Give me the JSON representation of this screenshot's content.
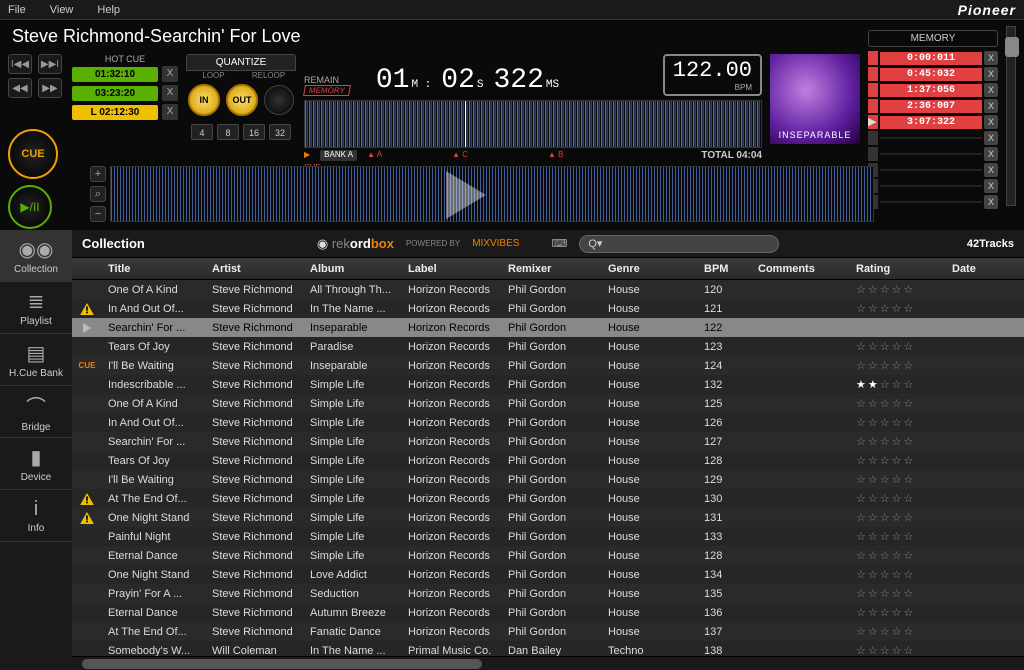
{
  "menu": {
    "file": "File",
    "view": "View",
    "help": "Help",
    "brand": "Pioneer"
  },
  "nowplaying": {
    "title": "Steve Richmond-Searchin' For Love",
    "hot_cue_label": "HOT   CUE",
    "cues": [
      {
        "time": "01:32:10",
        "color": "green"
      },
      {
        "time": "03:23:20",
        "color": "green"
      },
      {
        "time": "L 02:12:30",
        "color": "orange"
      }
    ],
    "cue_btn": "CUE",
    "play_btn": "▶/II",
    "quantize": "QUANTIZE",
    "loop": "LOOP",
    "reloop": "RELOOP",
    "in": "IN",
    "out": "OUT",
    "beats": [
      "4",
      "8",
      "16",
      "32"
    ],
    "remain": "REMAIN",
    "memory_tag": "MEMORY",
    "time_m": "01",
    "time_s": "02",
    "time_ms": "322",
    "unit_m": "M :",
    "unit_s": "S",
    "unit_ms": "MS",
    "bpm": "122.00",
    "bpm_label": "BPM",
    "bank": "BANK A",
    "cue_label": "CUE",
    "markers": [
      "▲ A",
      "▲ B",
      "▲ C"
    ],
    "total": "TOTAL 04:04",
    "album_art": "INSEPARABLE"
  },
  "memory": {
    "header": "MEMORY",
    "slots": [
      "0:00:011",
      "0:45:032",
      "1:37:056",
      "2:36:007",
      "3:07:322",
      "",
      "",
      "",
      "",
      ""
    ]
  },
  "library": {
    "side": [
      {
        "label": "Collection",
        "icon": "◉◉"
      },
      {
        "label": "Playlist",
        "icon": "≣"
      },
      {
        "label": "H.Cue Bank",
        "icon": "▤"
      },
      {
        "label": "Bridge",
        "icon": "⌒"
      },
      {
        "label": "Device",
        "icon": "▮"
      },
      {
        "label": "Info",
        "icon": "i"
      }
    ],
    "header": {
      "title": "Collection",
      "logo_rek": "rek",
      "logo_ord": "ord",
      "logo_box": "box",
      "powered": "POWERED BY",
      "mixvibes": "MIXVIBES",
      "search_placeholder": "",
      "count": "42Tracks"
    },
    "columns": [
      "",
      "Title",
      "Artist",
      "Album",
      "Label",
      "Remixer",
      "Genre",
      "BPM",
      "Comments",
      "Rating",
      "Date"
    ],
    "tracks": [
      {
        "ind": "",
        "title": "One Of A Kind",
        "artist": "Steve Richmond",
        "album": "All Through Th...",
        "label": "Horizon Records",
        "remixer": "Phil Gordon",
        "genre": "House",
        "bpm": "120",
        "rating": 0
      },
      {
        "ind": "warn",
        "title": "In And Out Of...",
        "artist": "Steve Richmond",
        "album": "In The Name ...",
        "label": "Horizon Records",
        "remixer": "Phil Gordon",
        "genre": "House",
        "bpm": "121",
        "rating": 0
      },
      {
        "ind": "play",
        "title": "Searchin' For ...",
        "artist": "Steve Richmond",
        "album": "Inseparable",
        "label": "Horizon Records",
        "remixer": "Phil Gordon",
        "genre": "House",
        "bpm": "122",
        "rating": 0,
        "selected": true
      },
      {
        "ind": "",
        "title": "Tears Of Joy",
        "artist": "Steve Richmond",
        "album": "Paradise",
        "label": "Horizon Records",
        "remixer": "Phil Gordon",
        "genre": "House",
        "bpm": "123",
        "rating": 0
      },
      {
        "ind": "cue",
        "title": "I'll Be Waiting",
        "artist": "Steve Richmond",
        "album": "Inseparable",
        "label": "Horizon Records",
        "remixer": "Phil Gordon",
        "genre": "House",
        "bpm": "124",
        "rating": 0
      },
      {
        "ind": "",
        "title": "Indescribable ...",
        "artist": "Steve Richmond",
        "album": "Simple Life",
        "label": "Horizon Records",
        "remixer": "Phil Gordon",
        "genre": "House",
        "bpm": "132",
        "rating": 2
      },
      {
        "ind": "",
        "title": "One Of A Kind",
        "artist": "Steve Richmond",
        "album": "Simple Life",
        "label": "Horizon Records",
        "remixer": "Phil Gordon",
        "genre": "House",
        "bpm": "125",
        "rating": 0
      },
      {
        "ind": "",
        "title": "In And Out Of...",
        "artist": "Steve Richmond",
        "album": "Simple Life",
        "label": "Horizon Records",
        "remixer": "Phil Gordon",
        "genre": "House",
        "bpm": "126",
        "rating": 0
      },
      {
        "ind": "",
        "title": "Searchin' For ...",
        "artist": "Steve Richmond",
        "album": "Simple Life",
        "label": "Horizon Records",
        "remixer": "Phil Gordon",
        "genre": "House",
        "bpm": "127",
        "rating": 0
      },
      {
        "ind": "",
        "title": "Tears Of Joy",
        "artist": "Steve Richmond",
        "album": "Simple Life",
        "label": "Horizon Records",
        "remixer": "Phil Gordon",
        "genre": "House",
        "bpm": "128",
        "rating": 0
      },
      {
        "ind": "",
        "title": "I'll Be Waiting",
        "artist": "Steve Richmond",
        "album": "Simple Life",
        "label": "Horizon Records",
        "remixer": "Phil Gordon",
        "genre": "House",
        "bpm": "129",
        "rating": 0
      },
      {
        "ind": "warn",
        "title": "At The End Of...",
        "artist": "Steve Richmond",
        "album": "Simple Life",
        "label": "Horizon Records",
        "remixer": "Phil Gordon",
        "genre": "House",
        "bpm": "130",
        "rating": 0
      },
      {
        "ind": "warn",
        "title": "One Night Stand",
        "artist": "Steve Richmond",
        "album": "Simple Life",
        "label": "Horizon Records",
        "remixer": "Phil Gordon",
        "genre": "House",
        "bpm": "131",
        "rating": 0
      },
      {
        "ind": "",
        "title": "Painful Night",
        "artist": "Steve Richmond",
        "album": "Simple Life",
        "label": "Horizon Records",
        "remixer": "Phil Gordon",
        "genre": "House",
        "bpm": "133",
        "rating": 0
      },
      {
        "ind": "",
        "title": "Eternal Dance",
        "artist": "Steve Richmond",
        "album": "Simple Life",
        "label": "Horizon Records",
        "remixer": "Phil Gordon",
        "genre": "House",
        "bpm": "128",
        "rating": 0
      },
      {
        "ind": "",
        "title": "One Night Stand",
        "artist": "Steve Richmond",
        "album": "Love Addict",
        "label": "Horizon Records",
        "remixer": "Phil Gordon",
        "genre": "House",
        "bpm": "134",
        "rating": 0
      },
      {
        "ind": "",
        "title": "Prayin' For A ...",
        "artist": "Steve Richmond",
        "album": "Seduction",
        "label": "Horizon Records",
        "remixer": "Phil Gordon",
        "genre": "House",
        "bpm": "135",
        "rating": 0
      },
      {
        "ind": "",
        "title": "Eternal Dance",
        "artist": "Steve Richmond",
        "album": "Autumn Breeze",
        "label": "Horizon Records",
        "remixer": "Phil Gordon",
        "genre": "House",
        "bpm": "136",
        "rating": 0
      },
      {
        "ind": "",
        "title": "At The End Of...",
        "artist": "Steve Richmond",
        "album": "Fanatic Dance",
        "label": "Horizon Records",
        "remixer": "Phil Gordon",
        "genre": "House",
        "bpm": "137",
        "rating": 0
      },
      {
        "ind": "",
        "title": "Somebody's W...",
        "artist": "Will Coleman",
        "album": "In The Name ...",
        "label": "Primal Music Co.",
        "remixer": "Dan Bailey",
        "genre": "Techno",
        "bpm": "138",
        "rating": 0
      }
    ]
  }
}
